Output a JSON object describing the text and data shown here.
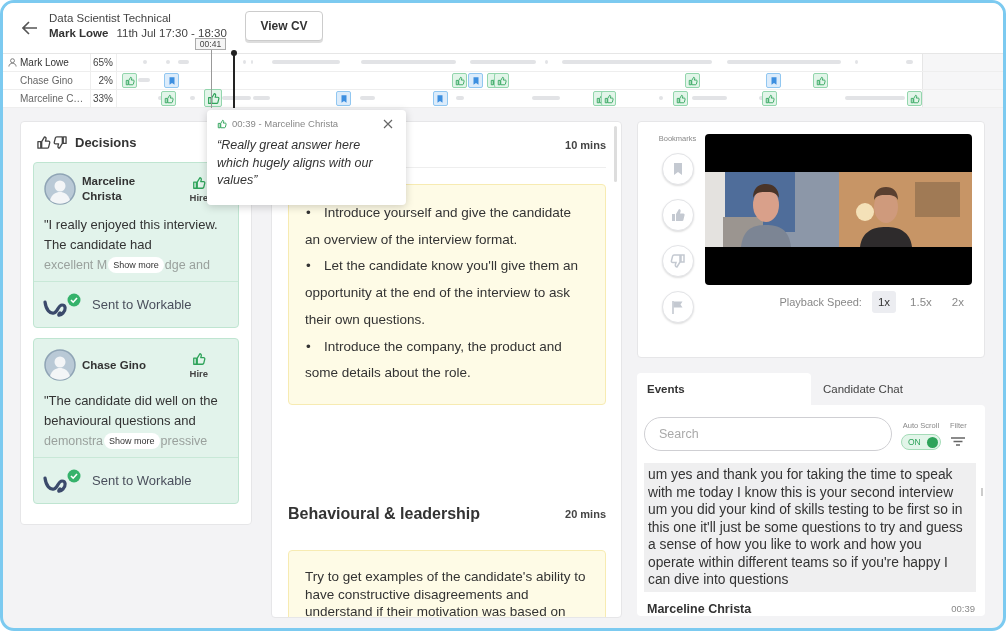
{
  "header": {
    "title": "Data Scientist Technical",
    "candidate": "Mark Lowe",
    "schedule": "11th Jul 17:30 - 18:30",
    "cv_button": "View CV"
  },
  "timeline": {
    "hover_time": "00:41",
    "level": 0.144,
    "rows": [
      {
        "name": "Mark Lowe",
        "kind": "candidate",
        "share": "65%"
      },
      {
        "name": "Chase Gino",
        "kind": "interviewer",
        "share": "2%",
        "markers": [
          {
            "kind": "like",
            "selected": false
          },
          {
            "kind": "bookmark",
            "selected": false
          },
          {
            "kind": "like",
            "selected": false
          },
          {
            "kind": "bookmark",
            "selected": false
          },
          {
            "kind": "like",
            "selected": false
          },
          {
            "kind": "like",
            "selected": false
          },
          {
            "kind": "like",
            "selected": false
          },
          {
            "kind": "bookmark",
            "selected": false
          },
          {
            "kind": "like",
            "selected": false
          }
        ]
      },
      {
        "name": "Marceline C…",
        "kind": "interviewer",
        "share": "33%",
        "markers": [
          {
            "kind": "like",
            "selected": false
          },
          {
            "kind": "like",
            "selected": true
          },
          {
            "kind": "bookmark",
            "selected": false
          },
          {
            "kind": "bookmark",
            "selected": false
          },
          {
            "kind": "like",
            "selected": false
          },
          {
            "kind": "like",
            "selected": false
          },
          {
            "kind": "like",
            "selected": false
          },
          {
            "kind": "like",
            "selected": false
          },
          {
            "kind": "like",
            "selected": false
          }
        ]
      }
    ]
  },
  "decisions": {
    "title": "Decisions",
    "cards": [
      {
        "name": "Marceline Christa",
        "verdict": "Hire",
        "comment": "\"I really enjoyed this interview. The candidate had",
        "fade_before": "excellent M",
        "fade_after": "dge and",
        "more": "Show more",
        "status": "Sent to Workable"
      },
      {
        "name": "Chase Gino",
        "verdict": "Hire",
        "comment": "\"The candidate did well on the behavioural questions and",
        "fade_before": "demonstra",
        "fade_after": "pressive",
        "more": "Show more",
        "status": "Sent to Workable"
      }
    ]
  },
  "guide": {
    "sections": [
      {
        "duration": "10 mins",
        "bullet_mark": "•",
        "bullets": [
          "Introduce yourself and give the candidate an overview of the interview format.",
          "Let the candidate know you'll give them an opportunity at the end of the interview to ask their own questions.",
          "Introduce the company, the product and some details about the role."
        ]
      },
      {
        "title": "Behavioural & leadership",
        "duration": "20 mins",
        "text": "Try to get examples of the candidate's ability to have constructive disagreements and understand if their motivation was based on"
      }
    ]
  },
  "popover": {
    "heading": "00:39 - Marceline Christa",
    "quote": "“Really great answer here which hugely aligns with our values”"
  },
  "player": {
    "bookmarks_label": "Bookmarks",
    "buttons": [
      {
        "kind": "bookmark"
      },
      {
        "kind": "like"
      },
      {
        "kind": "dislike"
      },
      {
        "kind": "flag"
      }
    ],
    "speed_label": "Playback Speed:",
    "speeds": [
      {
        "label": "1x",
        "selected": true
      },
      {
        "label": "1.5x",
        "selected": false
      },
      {
        "label": "2x",
        "selected": false
      }
    ]
  },
  "events": {
    "tabs": [
      {
        "label": "Events",
        "selected": true
      },
      {
        "label": "Candidate Chat",
        "selected": false
      }
    ],
    "search": {
      "placeholder": "Search"
    },
    "auto_scroll": {
      "label": "Auto Scroll",
      "on": true,
      "text": "ON"
    },
    "filter": {
      "label": "Filter"
    },
    "transcript": "um yes and thank you for taking the time to speak with me today I know this is your second interview um you did your kind of skills testing to be first so in this one it'll just be some questions to try and guess a sense of how you like to work and how you operate within different teams so if you're happy I can dive into questions",
    "entry": {
      "author": "Marceline Christa",
      "time": "00:39"
    }
  }
}
